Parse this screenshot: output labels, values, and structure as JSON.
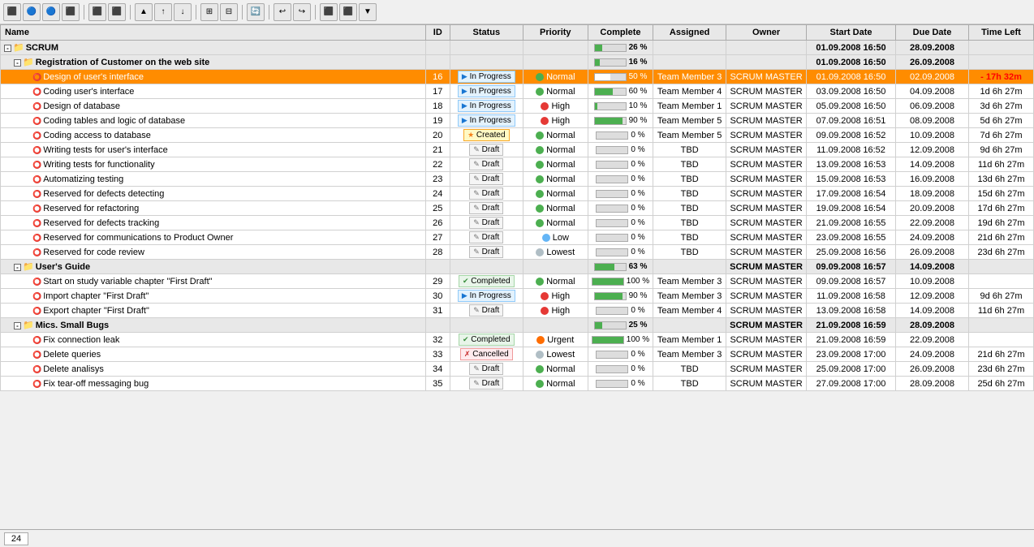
{
  "toolbar": {
    "buttons": [
      "⬅",
      "⬆",
      "⬇",
      "⬆⬇",
      "📋",
      "🔁",
      "🔃",
      "⬛",
      "▶",
      "⏸",
      "⬛",
      "📊",
      "📈",
      "⚙"
    ]
  },
  "columns": {
    "name": "Name",
    "id": "ID",
    "status": "Status",
    "priority": "Priority",
    "complete": "Complete",
    "assigned": "Assigned",
    "owner": "Owner",
    "startdate": "Start Date",
    "duedate": "Due Date",
    "timeleft": "Time Left"
  },
  "rows": [
    {
      "level": 0,
      "type": "group",
      "name": "SCRUM",
      "id": "",
      "status": "",
      "priority": "",
      "complete": "26 %",
      "completePct": 26,
      "assigned": "",
      "owner": "",
      "startdate": "01.09.2008 16:50",
      "duedate": "28.09.2008",
      "timeleft": "",
      "expand": "-",
      "icon": "🟡"
    },
    {
      "level": 1,
      "type": "subgroup",
      "name": "Registration of Customer on the web site",
      "id": "",
      "status": "",
      "priority": "",
      "complete": "16 %",
      "completePct": 16,
      "assigned": "",
      "owner": "",
      "startdate": "01.09.2008 16:50",
      "duedate": "26.09.2008",
      "timeleft": "",
      "expand": "-",
      "icon": "🟠"
    },
    {
      "level": 2,
      "type": "task-selected",
      "name": "Design of user's interface",
      "id": "16",
      "status": "In Progress",
      "statusClass": "status-inprogress",
      "statusIcon": "▶",
      "priority": "Normal",
      "priorityClass": "dot-normal",
      "priorityIcon": "🟢",
      "complete": "50 %",
      "completePct": 50,
      "assigned": "Team Member 3",
      "owner": "SCRUM MASTER",
      "startdate": "01.09.2008 16:50",
      "duedate": "02.09.2008",
      "timeleft": "- 17h 32m",
      "timeoverdue": true,
      "expand": "",
      "icon": "⭕"
    },
    {
      "level": 2,
      "type": "task",
      "name": "Coding user's interface",
      "id": "17",
      "status": "In Progress",
      "statusClass": "status-inprogress",
      "statusIcon": "▶",
      "priority": "Normal",
      "priorityClass": "dot-normal",
      "priorityIcon": "🟢",
      "complete": "60 %",
      "completePct": 60,
      "assigned": "Team Member 4",
      "owner": "SCRUM MASTER",
      "startdate": "03.09.2008 16:50",
      "duedate": "04.09.2008",
      "timeleft": "1d 6h 27m",
      "timeoverdue": false,
      "expand": "",
      "icon": "⭕"
    },
    {
      "level": 2,
      "type": "task",
      "name": "Design of database",
      "id": "18",
      "status": "In Progress",
      "statusClass": "status-inprogress",
      "statusIcon": "▶",
      "priority": "High",
      "priorityClass": "dot-high",
      "priorityIcon": "🔴",
      "complete": "10 %",
      "completePct": 10,
      "assigned": "Team Member 1",
      "owner": "SCRUM MASTER",
      "startdate": "05.09.2008 16:50",
      "duedate": "06.09.2008",
      "timeleft": "3d 6h 27m",
      "timeoverdue": false,
      "expand": "",
      "icon": "⭕"
    },
    {
      "level": 2,
      "type": "task",
      "name": "Coding tables and logic of database",
      "id": "19",
      "status": "In Progress",
      "statusClass": "status-inprogress",
      "statusIcon": "▶",
      "priority": "High",
      "priorityClass": "dot-high",
      "priorityIcon": "🔴",
      "complete": "90 %",
      "completePct": 90,
      "assigned": "Team Member 5",
      "owner": "SCRUM MASTER",
      "startdate": "07.09.2008 16:51",
      "duedate": "08.09.2008",
      "timeleft": "5d 6h 27m",
      "timeoverdue": false,
      "expand": "",
      "icon": "⭕"
    },
    {
      "level": 2,
      "type": "task",
      "name": "Coding access to database",
      "id": "20",
      "status": "Created",
      "statusClass": "status-created",
      "statusIcon": "⭐",
      "priority": "Normal",
      "priorityClass": "dot-normal",
      "priorityIcon": "🟢",
      "complete": "0 %",
      "completePct": 0,
      "assigned": "Team Member 5",
      "owner": "SCRUM MASTER",
      "startdate": "09.09.2008 16:52",
      "duedate": "10.09.2008",
      "timeleft": "7d 6h 27m",
      "timeoverdue": false,
      "expand": "",
      "icon": "⭕"
    },
    {
      "level": 2,
      "type": "task",
      "name": "Writing tests for user's interface",
      "id": "21",
      "status": "Draft",
      "statusClass": "status-draft",
      "statusIcon": "📝",
      "priority": "Normal",
      "priorityClass": "dot-normal",
      "priorityIcon": "🟢",
      "complete": "0 %",
      "completePct": 0,
      "assigned": "TBD",
      "owner": "SCRUM MASTER",
      "startdate": "11.09.2008 16:52",
      "duedate": "12.09.2008",
      "timeleft": "9d 6h 27m",
      "timeoverdue": false,
      "expand": "",
      "icon": "⭕"
    },
    {
      "level": 2,
      "type": "task",
      "name": "Writing tests for functionality",
      "id": "22",
      "status": "Draft",
      "statusClass": "status-draft",
      "statusIcon": "📝",
      "priority": "Normal",
      "priorityClass": "dot-normal",
      "priorityIcon": "🟢",
      "complete": "0 %",
      "completePct": 0,
      "assigned": "TBD",
      "owner": "SCRUM MASTER",
      "startdate": "13.09.2008 16:53",
      "duedate": "14.09.2008",
      "timeleft": "11d 6h 27m",
      "timeoverdue": false,
      "expand": "",
      "icon": "⭕"
    },
    {
      "level": 2,
      "type": "task",
      "name": "Automatizing testing",
      "id": "23",
      "status": "Draft",
      "statusClass": "status-draft",
      "statusIcon": "📝",
      "priority": "Normal",
      "priorityClass": "dot-normal",
      "priorityIcon": "🟢",
      "complete": "0 %",
      "completePct": 0,
      "assigned": "TBD",
      "owner": "SCRUM MASTER",
      "startdate": "15.09.2008 16:53",
      "duedate": "16.09.2008",
      "timeleft": "13d 6h 27m",
      "timeoverdue": false,
      "expand": "",
      "icon": "⭕"
    },
    {
      "level": 2,
      "type": "task",
      "name": "Reserved for defects detecting",
      "id": "24",
      "status": "Draft",
      "statusClass": "status-draft",
      "statusIcon": "📝",
      "priority": "Normal",
      "priorityClass": "dot-normal",
      "priorityIcon": "🟢",
      "complete": "0 %",
      "completePct": 0,
      "assigned": "TBD",
      "owner": "SCRUM MASTER",
      "startdate": "17.09.2008 16:54",
      "duedate": "18.09.2008",
      "timeleft": "15d 6h 27m",
      "timeoverdue": false,
      "expand": "",
      "icon": "⭕"
    },
    {
      "level": 2,
      "type": "task",
      "name": "Reserved for refactoring",
      "id": "25",
      "status": "Draft",
      "statusClass": "status-draft",
      "statusIcon": "📝",
      "priority": "Normal",
      "priorityClass": "dot-normal",
      "priorityIcon": "🟢",
      "complete": "0 %",
      "completePct": 0,
      "assigned": "TBD",
      "owner": "SCRUM MASTER",
      "startdate": "19.09.2008 16:54",
      "duedate": "20.09.2008",
      "timeleft": "17d 6h 27m",
      "timeoverdue": false,
      "expand": "",
      "icon": "⭕"
    },
    {
      "level": 2,
      "type": "task",
      "name": "Reserved for defects tracking",
      "id": "26",
      "status": "Draft",
      "statusClass": "status-draft",
      "statusIcon": "📝",
      "priority": "Normal",
      "priorityClass": "dot-normal",
      "priorityIcon": "🟢",
      "complete": "0 %",
      "completePct": 0,
      "assigned": "TBD",
      "owner": "SCRUM MASTER",
      "startdate": "21.09.2008 16:55",
      "duedate": "22.09.2008",
      "timeleft": "19d 6h 27m",
      "timeoverdue": false,
      "expand": "",
      "icon": "⭕"
    },
    {
      "level": 2,
      "type": "task",
      "name": "Reserved for communications to Product Owner",
      "id": "27",
      "status": "Draft",
      "statusClass": "status-draft",
      "statusIcon": "📝",
      "priority": "Low",
      "priorityClass": "dot-low",
      "priorityIcon": "🔵",
      "complete": "0 %",
      "completePct": 0,
      "assigned": "TBD",
      "owner": "SCRUM MASTER",
      "startdate": "23.09.2008 16:55",
      "duedate": "24.09.2008",
      "timeleft": "21d 6h 27m",
      "timeoverdue": false,
      "expand": "",
      "icon": "⭕"
    },
    {
      "level": 2,
      "type": "task",
      "name": "Reserved for code review",
      "id": "28",
      "status": "Draft",
      "statusClass": "status-draft",
      "statusIcon": "📝",
      "priority": "Lowest",
      "priorityClass": "dot-lowest",
      "priorityIcon": "⬜",
      "complete": "0 %",
      "completePct": 0,
      "assigned": "TBD",
      "owner": "SCRUM MASTER",
      "startdate": "25.09.2008 16:56",
      "duedate": "26.09.2008",
      "timeleft": "23d 6h 27m",
      "timeoverdue": false,
      "expand": "",
      "icon": "⭕"
    },
    {
      "level": 1,
      "type": "subgroup",
      "name": "User's Guide",
      "id": "",
      "status": "",
      "priority": "",
      "complete": "63 %",
      "completePct": 63,
      "assigned": "",
      "owner": "SCRUM MASTER",
      "startdate": "09.09.2008 16:57",
      "duedate": "14.09.2008",
      "timeleft": "",
      "expand": "-",
      "icon": "🟠"
    },
    {
      "level": 2,
      "type": "task",
      "name": "Start on study variable chapter \"First Draft\"",
      "id": "29",
      "status": "Completed",
      "statusClass": "status-completed",
      "statusIcon": "✔",
      "priority": "Normal",
      "priorityClass": "dot-normal",
      "priorityIcon": "🟢",
      "complete": "100 %",
      "completePct": 100,
      "assigned": "Team Member 3",
      "owner": "SCRUM MASTER",
      "startdate": "09.09.2008 16:57",
      "duedate": "10.09.2008",
      "timeleft": "",
      "timeoverdue": false,
      "expand": "",
      "icon": "⭕"
    },
    {
      "level": 2,
      "type": "task",
      "name": "Import chapter \"First Draft\"",
      "id": "30",
      "status": "In Progress",
      "statusClass": "status-inprogress",
      "statusIcon": "▶",
      "priority": "High",
      "priorityClass": "dot-high",
      "priorityIcon": "🔴",
      "complete": "90 %",
      "completePct": 90,
      "assigned": "Team Member 3",
      "owner": "SCRUM MASTER",
      "startdate": "11.09.2008 16:58",
      "duedate": "12.09.2008",
      "timeleft": "9d 6h 27m",
      "timeoverdue": false,
      "expand": "",
      "icon": "⭕"
    },
    {
      "level": 2,
      "type": "task",
      "name": "Export chapter \"First Draft\"",
      "id": "31",
      "status": "Draft",
      "statusClass": "status-draft",
      "statusIcon": "📝",
      "priority": "High",
      "priorityClass": "dot-high",
      "priorityIcon": "🔴",
      "complete": "0 %",
      "completePct": 0,
      "assigned": "Team Member 4",
      "owner": "SCRUM MASTER",
      "startdate": "13.09.2008 16:58",
      "duedate": "14.09.2008",
      "timeleft": "11d 6h 27m",
      "timeoverdue": false,
      "expand": "",
      "icon": "⭕"
    },
    {
      "level": 1,
      "type": "subgroup",
      "name": "Mics. Small Bugs",
      "id": "",
      "status": "",
      "priority": "",
      "complete": "25 %",
      "completePct": 25,
      "assigned": "",
      "owner": "SCRUM MASTER",
      "startdate": "21.09.2008 16:59",
      "duedate": "28.09.2008",
      "timeleft": "",
      "expand": "-",
      "icon": "🟠"
    },
    {
      "level": 2,
      "type": "task",
      "name": "Fix connection leak",
      "id": "32",
      "status": "Completed",
      "statusClass": "status-completed",
      "statusIcon": "✔",
      "priority": "Urgent",
      "priorityClass": "dot-urgent",
      "priorityIcon": "🟠",
      "complete": "100 %",
      "completePct": 100,
      "assigned": "Team Member 1",
      "owner": "SCRUM MASTER",
      "startdate": "21.09.2008 16:59",
      "duedate": "22.09.2008",
      "timeleft": "",
      "timeoverdue": false,
      "expand": "",
      "icon": "⭕"
    },
    {
      "level": 2,
      "type": "task",
      "name": "Delete queries",
      "id": "33",
      "status": "Cancelled",
      "statusClass": "status-cancelled",
      "statusIcon": "✗",
      "priority": "Lowest",
      "priorityClass": "dot-lowest",
      "priorityIcon": "⬜",
      "complete": "0 %",
      "completePct": 0,
      "assigned": "Team Member 3",
      "owner": "SCRUM MASTER",
      "startdate": "23.09.2008 17:00",
      "duedate": "24.09.2008",
      "timeleft": "21d 6h 27m",
      "timeoverdue": false,
      "expand": "",
      "icon": "⭕"
    },
    {
      "level": 2,
      "type": "task",
      "name": "Delete analisys",
      "id": "34",
      "status": "Draft",
      "statusClass": "status-draft",
      "statusIcon": "📝",
      "priority": "Normal",
      "priorityClass": "dot-normal",
      "priorityIcon": "🟢",
      "complete": "0 %",
      "completePct": 0,
      "assigned": "TBD",
      "owner": "SCRUM MASTER",
      "startdate": "25.09.2008 17:00",
      "duedate": "26.09.2008",
      "timeleft": "23d 6h 27m",
      "timeoverdue": false,
      "expand": "",
      "icon": "⭕"
    },
    {
      "level": 2,
      "type": "task",
      "name": "Fix tear-off messaging bug",
      "id": "35",
      "status": "Draft",
      "statusClass": "status-draft",
      "statusIcon": "📝",
      "priority": "Normal",
      "priorityClass": "dot-normal",
      "priorityIcon": "🟢",
      "complete": "0 %",
      "completePct": 0,
      "assigned": "TBD",
      "owner": "SCRUM MASTER",
      "startdate": "27.09.2008 17:00",
      "duedate": "28.09.2008",
      "timeleft": "25d 6h 27m",
      "timeoverdue": false,
      "expand": "",
      "icon": "⭕"
    }
  ],
  "footer": {
    "page": "24"
  }
}
